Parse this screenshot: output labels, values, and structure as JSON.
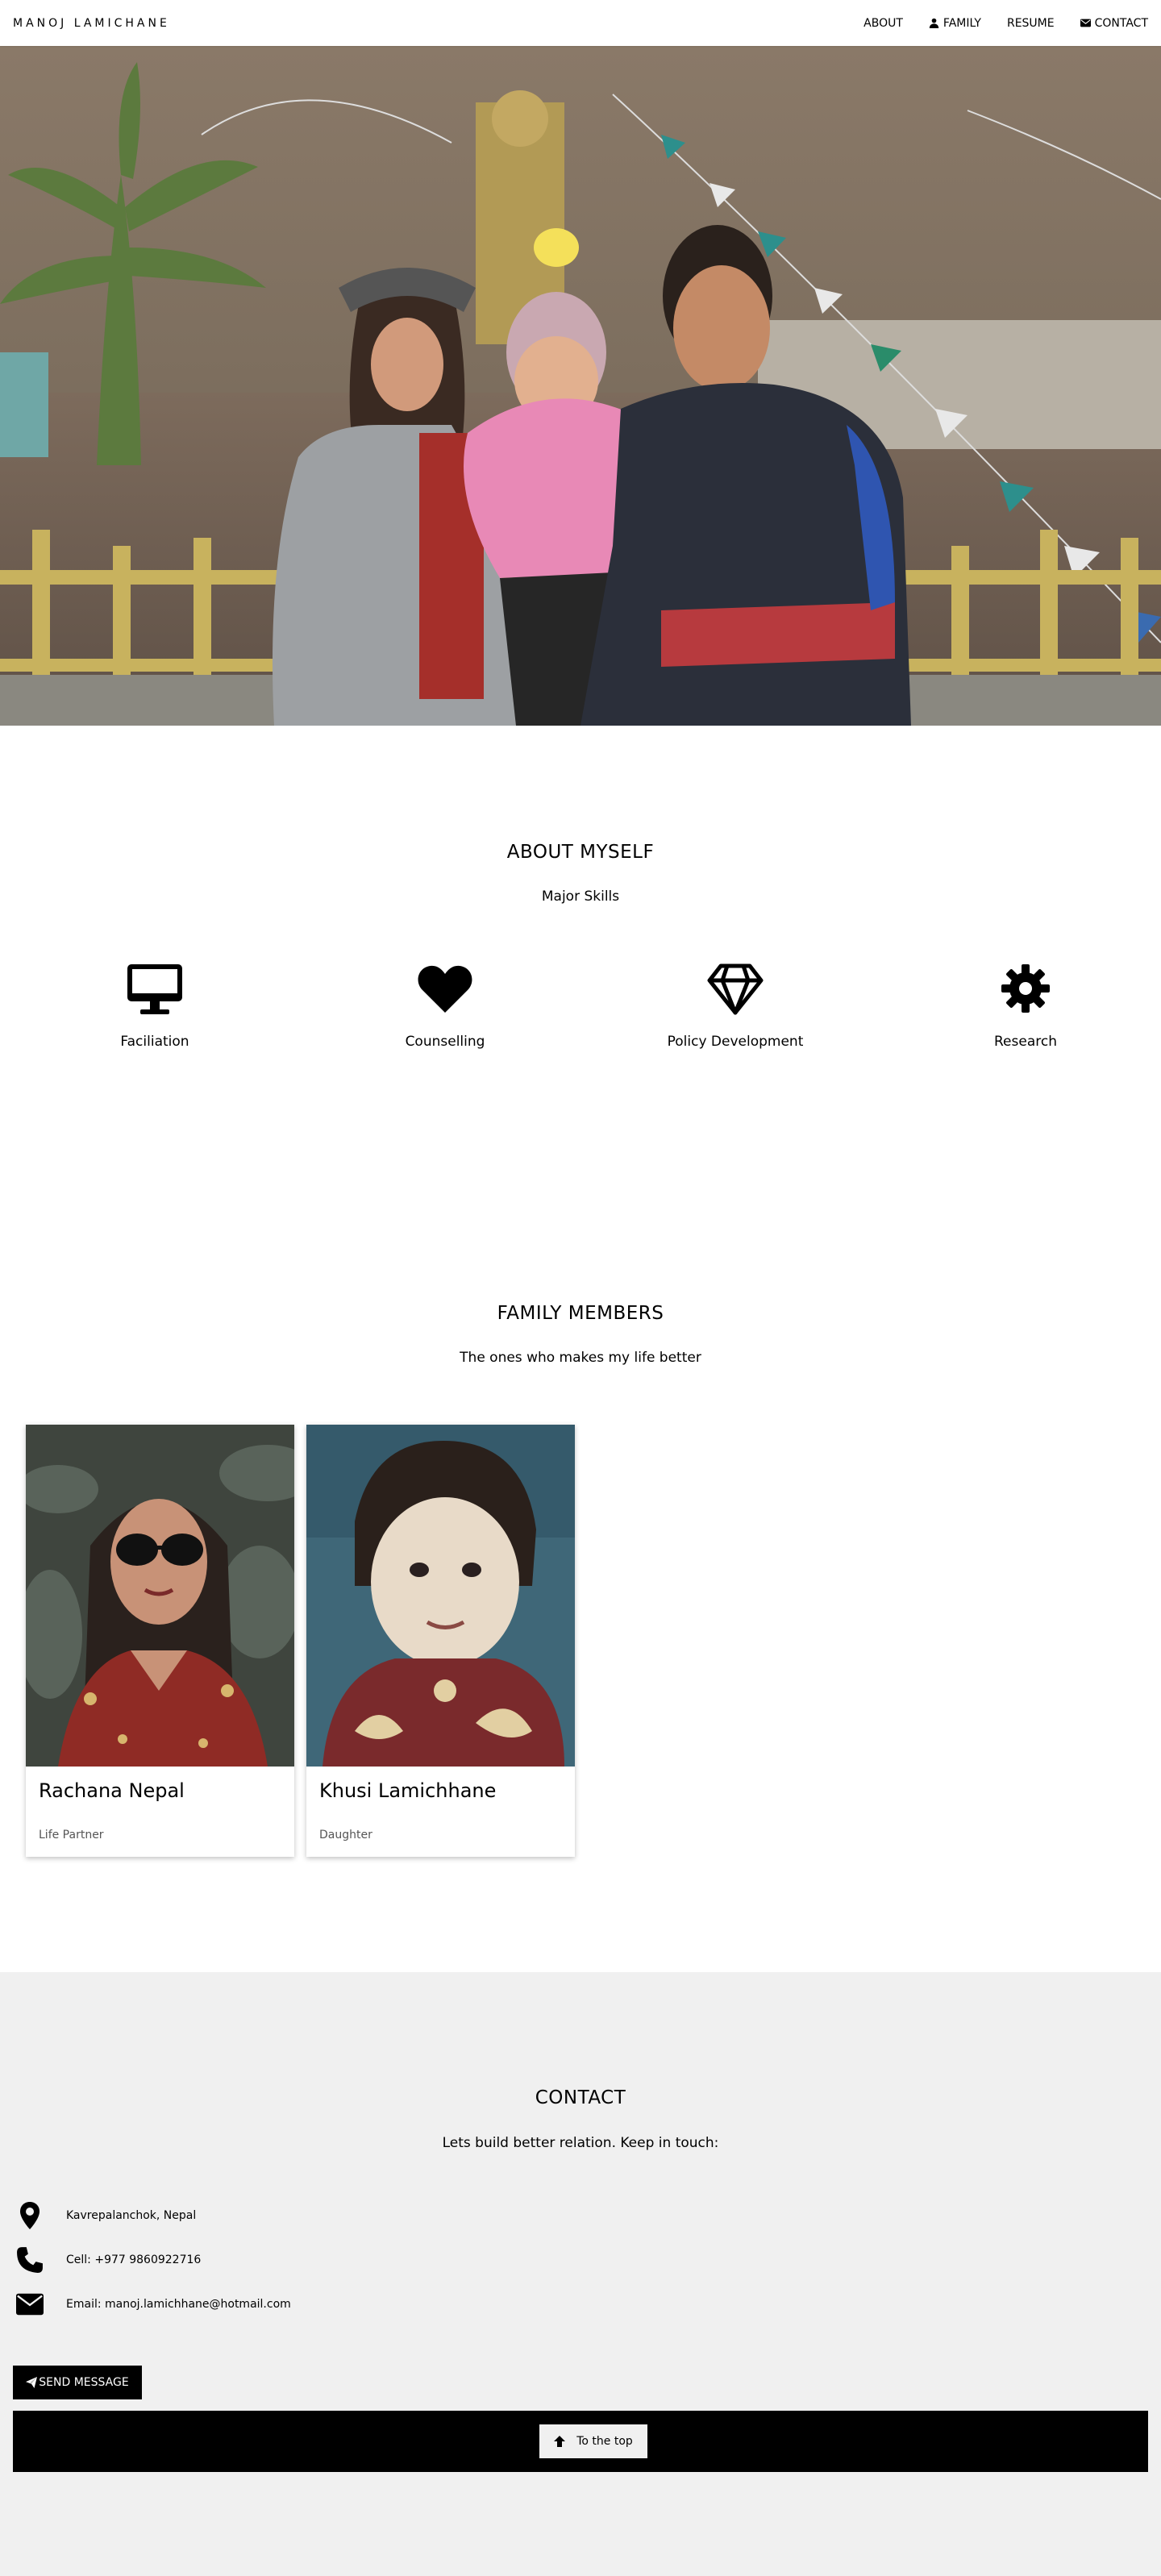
{
  "nav": {
    "brand": "MANOJ LAMICHANE",
    "items": [
      {
        "label": "ABOUT",
        "icon": ""
      },
      {
        "label": "FAMILY",
        "icon": "user-icon"
      },
      {
        "label": "RESUME",
        "icon": ""
      },
      {
        "label": "CONTACT",
        "icon": "envelope-icon"
      }
    ]
  },
  "about": {
    "title": "ABOUT MYSELF",
    "subtitle": "Major Skills",
    "skills": [
      {
        "label": "Faciliation",
        "icon": "desktop-icon"
      },
      {
        "label": "Counselling",
        "icon": "heart-icon"
      },
      {
        "label": "Policy Development",
        "icon": "diamond-icon"
      },
      {
        "label": "Research",
        "icon": "gear-icon"
      }
    ]
  },
  "family": {
    "title": "FAMILY MEMBERS",
    "subtitle": "The ones who makes my life better",
    "members": [
      {
        "name": "Rachana Nepal",
        "role": "Life Partner"
      },
      {
        "name": "Khusi Lamichhane",
        "role": "Daughter"
      }
    ]
  },
  "contact": {
    "title": "CONTACT",
    "subtitle": "Lets build better relation. Keep in touch:",
    "rows": [
      {
        "text": "Kavrepalanchok, Nepal",
        "icon": "map-marker-icon"
      },
      {
        "text": "Cell: +977 9860922716",
        "icon": "phone-icon"
      },
      {
        "text": "Email: manoj.lamichhane@hotmail.com",
        "icon": "envelope-icon"
      }
    ],
    "send_label": "SEND MESSAGE",
    "top_label": "To the top"
  },
  "colors": {
    "contact_bg": "#f0f0f0",
    "footer_bg": "#000000",
    "button_bg": "#000000"
  }
}
